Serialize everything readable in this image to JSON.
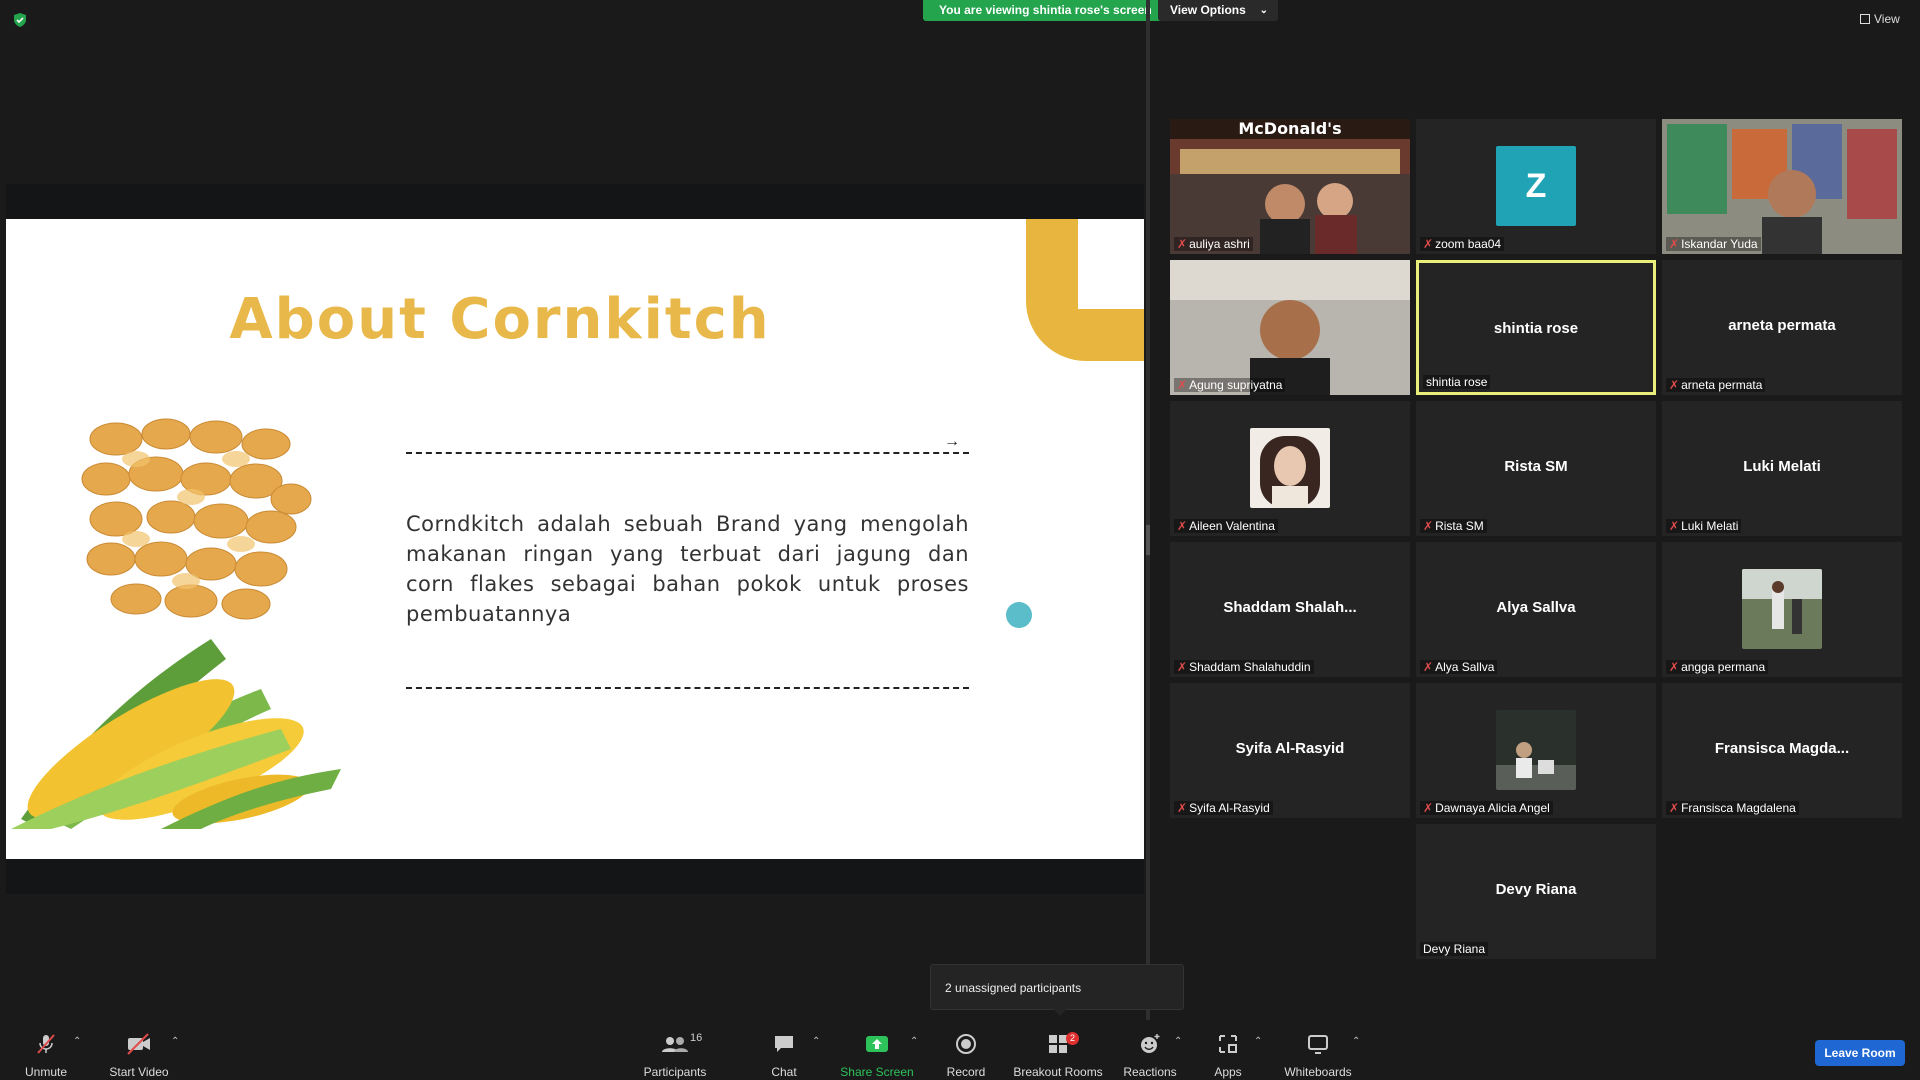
{
  "top": {
    "viewing_banner": "You are viewing shintia rose's screen",
    "view_options": "View Options",
    "view": "View"
  },
  "slide": {
    "title": "About Cornkitch",
    "body": "Corndkitch adalah sebuah Brand yang mengolah makanan ringan yang terbuat dari jagung dan corn flakes sebagai bahan pokok untuk proses pembuatannya",
    "arrow": "→"
  },
  "participants": [
    {
      "name": "auliya ashri",
      "kind": "video"
    },
    {
      "name": "zoom baa04",
      "kind": "letter",
      "letter": "Z"
    },
    {
      "name": "Iskandar Yuda",
      "kind": "video"
    },
    {
      "name": "Agung supriyatna",
      "kind": "video"
    },
    {
      "name": "shintia rose",
      "kind": "name",
      "display": "shintia rose"
    },
    {
      "name": "arneta permata",
      "kind": "name",
      "display": "arneta permata"
    },
    {
      "name": "Aileen Valentina",
      "kind": "photo"
    },
    {
      "name": "Rista SM",
      "kind": "name",
      "display": "Rista SM"
    },
    {
      "name": "Luki Melati",
      "kind": "name",
      "display": "Luki Melati"
    },
    {
      "name": "Shaddam Shalahuddin",
      "kind": "name",
      "display": "Shaddam  Shalah..."
    },
    {
      "name": "Alya Sallva",
      "kind": "name",
      "display": "Alya Sallva"
    },
    {
      "name": "angga permana",
      "kind": "photo"
    },
    {
      "name": "Syifa Al-Rasyid",
      "kind": "name",
      "display": "Syifa Al-Rasyid"
    },
    {
      "name": "Dawnaya Alicia Angel",
      "kind": "photo"
    },
    {
      "name": "Fransisca Magdalena",
      "kind": "name",
      "display": "Fransisca  Magda..."
    },
    {
      "name": "Devy Riana",
      "kind": "name",
      "display": "Devy Riana"
    }
  ],
  "toolbar": {
    "unmute": "Unmute",
    "start_video": "Start Video",
    "participants": "Participants",
    "participants_count": "16",
    "chat": "Chat",
    "share_screen": "Share Screen",
    "record": "Record",
    "breakout_rooms": "Breakout Rooms",
    "breakout_badge": "2",
    "reactions": "Reactions",
    "apps": "Apps",
    "whiteboards": "Whiteboards",
    "leave_room": "Leave Room",
    "unassigned": "2 unassigned participants"
  },
  "colors": {
    "accent_green": "#23a44d",
    "leave_blue": "#1f67d3",
    "title_gold": "#e8b84a",
    "active_border": "#e8f07a"
  }
}
